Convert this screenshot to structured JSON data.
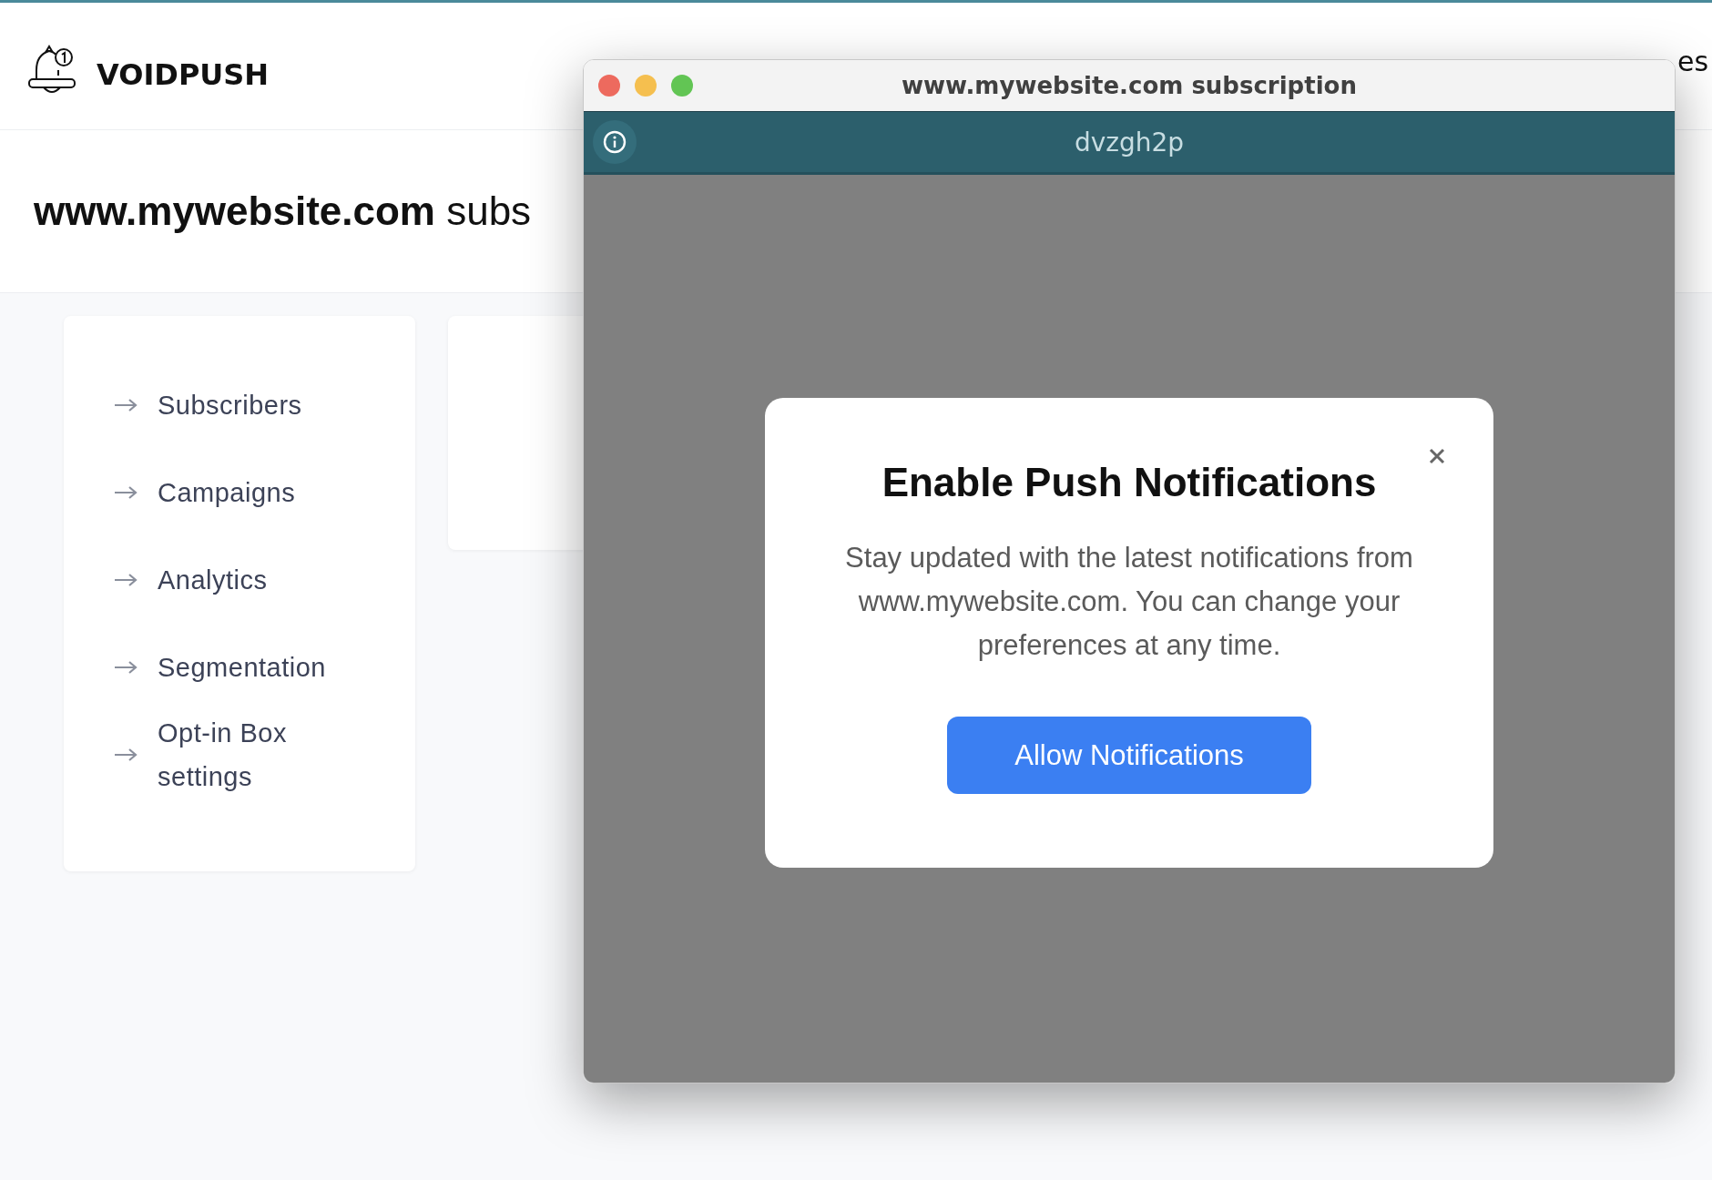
{
  "brand": {
    "name": "VOIDPUSH"
  },
  "nav": {
    "visible_text": "es"
  },
  "page_title": {
    "bold": "www.mywebsite.com",
    "rest": "subs"
  },
  "sidebar": {
    "items": [
      {
        "label": "Subscribers"
      },
      {
        "label": "Campaigns"
      },
      {
        "label": "Analytics"
      },
      {
        "label": "Segmentation"
      },
      {
        "label": "Opt-in Box settings"
      }
    ]
  },
  "window": {
    "title": "www.mywebsite.com subscription",
    "toolbar_text": "dvzgh2p"
  },
  "dialog": {
    "title": "Enable Push Notifications",
    "message": "Stay updated with the latest notifications from www.mywebsite.com. You can change your preferences at any time.",
    "button": "Allow Notifications"
  }
}
